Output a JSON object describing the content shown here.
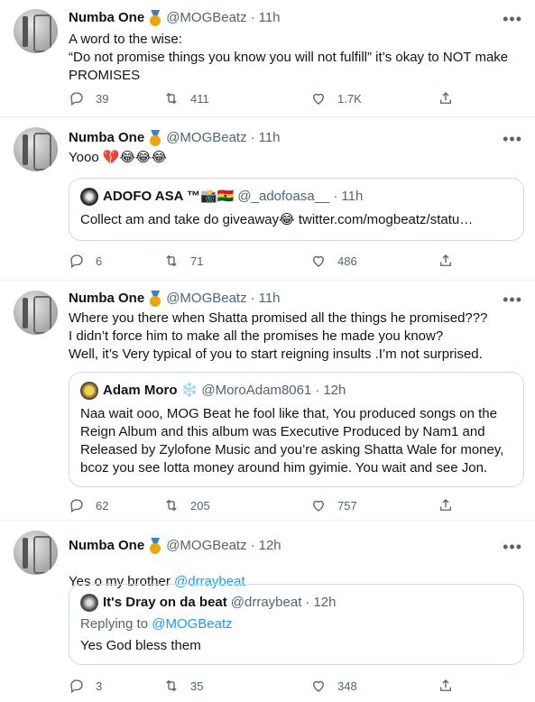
{
  "tweets": [
    {
      "name": "Numba One",
      "handle": "@MOGBeatz",
      "time": "11h",
      "text": "A word to the wise:\n“Do not promise things you know you will not fulfill” it’s okay to NOT make PROMISES",
      "replies": "39",
      "retweets": "411",
      "likes": "1.7K"
    },
    {
      "name": "Numba One",
      "handle": "@MOGBeatz",
      "time": "11h",
      "text": "Yooo 💔😂😂😂",
      "quote": {
        "name": "ADOFO ASA ™📸🇬🇭",
        "handle": "@_adofoasa__",
        "time": "11h",
        "text": "Collect am and take do giveaway😂 twitter.com/mogbeatz/statu…"
      },
      "replies": "6",
      "retweets": "71",
      "likes": "486"
    },
    {
      "name": "Numba One",
      "handle": "@MOGBeatz",
      "time": "11h",
      "text": "Where you there when Shatta promised all the things he promised???\nI didn’t force him to make all the promises he made you know?\nWell, it’s Very typical of you to start reigning insults .I’m not surprised.",
      "quote": {
        "name": "Adam Moro ❄️",
        "handle": "@MoroAdam8061",
        "time": "12h",
        "text": "Naa wait ooo, MOG Beat he fool like that, You produced songs on the Reign Album and this album was Executive Produced by Nam1 and Released by Zylofone Music and you’re asking Shatta Wale for money, bcoz you see lotta money around him gyimie. You wait and see Jon."
      },
      "replies": "62",
      "retweets": "205",
      "likes": "757"
    },
    {
      "name": "Numba One",
      "handle": "@MOGBeatz",
      "time": "12h",
      "text_prefix": "Yes o my brother ",
      "text_mention": "@drraybeat",
      "quote": {
        "name": "It's Dray on da beat",
        "handle": "@drraybeat",
        "time": "12h",
        "replying_label": "Replying to ",
        "replying_to": "@MOGBeatz",
        "text": "Yes God bless them"
      },
      "replies": "3",
      "retweets": "35",
      "likes": "348"
    }
  ],
  "ui": {
    "more": "•••",
    "sep": "·"
  },
  "colors": {
    "accent": "#1d9bf0",
    "secondary": "#536471",
    "border": "#cfd9de"
  },
  "icons": [
    "reply-icon",
    "retweet-icon",
    "like-icon",
    "share-icon",
    "more-icon",
    "medal-icon"
  ]
}
